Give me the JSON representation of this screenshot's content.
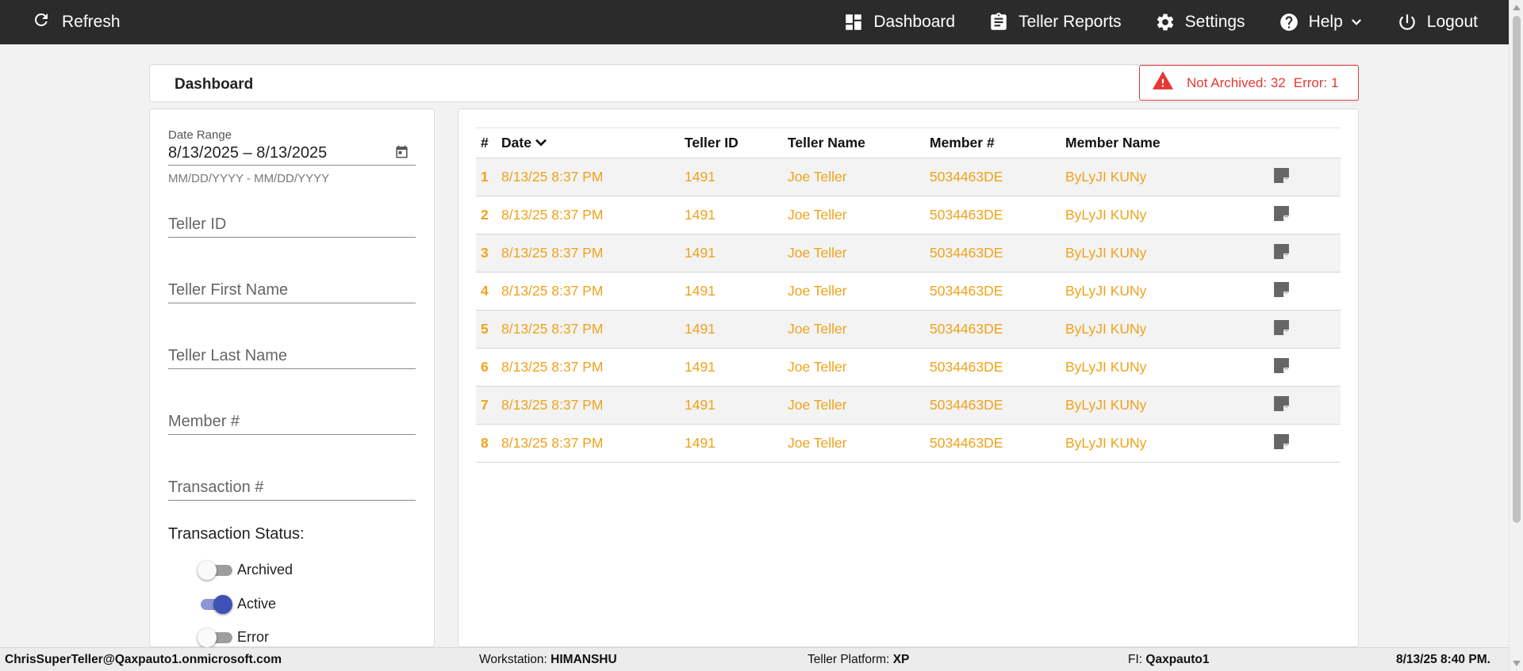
{
  "topbar": {
    "refresh_label": "Refresh",
    "nav": [
      {
        "label": "Dashboard",
        "icon": "dashboard-icon"
      },
      {
        "label": "Teller Reports",
        "icon": "clipboard-icon"
      },
      {
        "label": "Settings",
        "icon": "gear-icon"
      },
      {
        "label": "Help",
        "icon": "help-icon"
      },
      {
        "label": "Logout",
        "icon": "power-icon"
      }
    ]
  },
  "header": {
    "title": "Dashboard",
    "alert": {
      "not_archived_label": "Not Archived: 32",
      "error_label": "Error: 1",
      "color": "#e53935"
    }
  },
  "filters": {
    "date_range": {
      "label": "Date Range",
      "value": "8/13/2025 – 8/13/2025",
      "hint": "MM/DD/YYYY - MM/DD/YYYY"
    },
    "teller_id_placeholder": "Teller ID",
    "teller_first_name_placeholder": "Teller First Name",
    "teller_last_name_placeholder": "Teller Last Name",
    "member_number_placeholder": "Member #",
    "transaction_number_placeholder": "Transaction #",
    "status_label": "Transaction Status:",
    "status_toggles": [
      {
        "label": "Archived",
        "on": false
      },
      {
        "label": "Active",
        "on": true
      },
      {
        "label": "Error",
        "on": false
      }
    ]
  },
  "table": {
    "columns": [
      "#",
      "Date",
      "Teller ID",
      "Teller Name",
      "Member #",
      "Member Name"
    ],
    "row_color": "#f0a21b",
    "rows": [
      {
        "num": "1",
        "date": "8/13/25 8:37 PM",
        "teller_id": "1491",
        "teller_name": "Joe Teller",
        "member_number": "5034463DE",
        "member_name": "ByLyJI KUNy"
      },
      {
        "num": "2",
        "date": "8/13/25 8:37 PM",
        "teller_id": "1491",
        "teller_name": "Joe Teller",
        "member_number": "5034463DE",
        "member_name": "ByLyJI KUNy"
      },
      {
        "num": "3",
        "date": "8/13/25 8:37 PM",
        "teller_id": "1491",
        "teller_name": "Joe Teller",
        "member_number": "5034463DE",
        "member_name": "ByLyJI KUNy"
      },
      {
        "num": "4",
        "date": "8/13/25 8:37 PM",
        "teller_id": "1491",
        "teller_name": "Joe Teller",
        "member_number": "5034463DE",
        "member_name": "ByLyJI KUNy"
      },
      {
        "num": "5",
        "date": "8/13/25 8:37 PM",
        "teller_id": "1491",
        "teller_name": "Joe Teller",
        "member_number": "5034463DE",
        "member_name": "ByLyJI KUNy"
      },
      {
        "num": "6",
        "date": "8/13/25 8:37 PM",
        "teller_id": "1491",
        "teller_name": "Joe Teller",
        "member_number": "5034463DE",
        "member_name": "ByLyJI KUNy"
      },
      {
        "num": "7",
        "date": "8/13/25 8:37 PM",
        "teller_id": "1491",
        "teller_name": "Joe Teller",
        "member_number": "5034463DE",
        "member_name": "ByLyJI KUNy"
      },
      {
        "num": "8",
        "date": "8/13/25 8:37 PM",
        "teller_id": "1491",
        "teller_name": "Joe Teller",
        "member_number": "5034463DE",
        "member_name": "ByLyJI KUNy"
      }
    ]
  },
  "statusbar": {
    "user": "ChrisSuperTeller@Qaxpauto1.onmicrosoft.com",
    "workstation_label": "Workstation:",
    "workstation_value": "HIMANSHU",
    "platform_label": "Teller Platform:",
    "platform_value": "XP",
    "fi_label": "FI:",
    "fi_value": "Qaxpauto1",
    "datetime": "8/13/25 8:40 PM."
  }
}
